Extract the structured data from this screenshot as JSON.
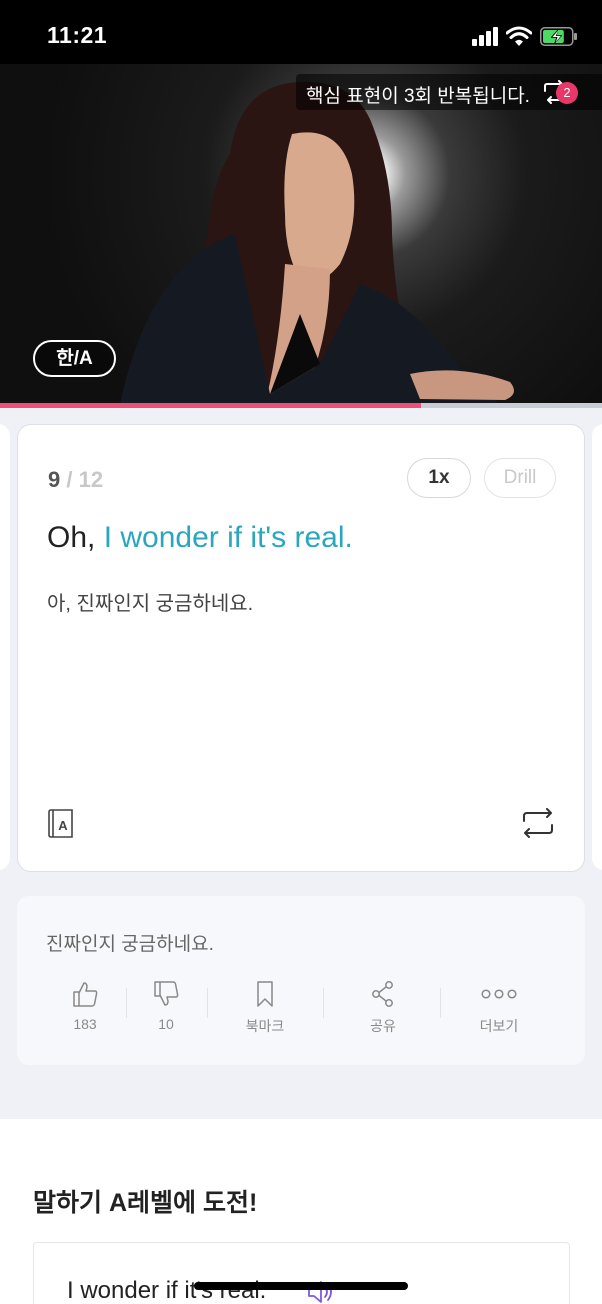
{
  "status_bar": {
    "time": "11:21",
    "battery_level": 0.8
  },
  "video": {
    "repeat_banner": "핵심 표현이 3회 반복됩니다.",
    "repeat_badge": "2",
    "lang_toggle": "한/A",
    "progress": 0.7
  },
  "card": {
    "current": "9",
    "total": "/ 12",
    "speed_label": "1x",
    "drill_label": "Drill",
    "sentence_plain": "Oh,",
    "sentence_highlight": "I wonder if it's real.",
    "translation": "아, 진짜인지 궁금하네요."
  },
  "info": {
    "text": "진짜인지 궁금하네요.",
    "actions": {
      "like": "183",
      "dislike": "10",
      "bookmark": "북마크",
      "share": "공유",
      "more": "더보기"
    }
  },
  "speaking": {
    "title": "말하기 A레벨에 도전!",
    "sentence": "I wonder if it's real."
  },
  "colors": {
    "accent_teal": "#2aa7bd",
    "progress_pink": "#ee4f7a",
    "badge_pink": "#e8386a",
    "speaker_purple": "#7b57e0"
  },
  "icons": [
    "signal-icon",
    "wifi-icon",
    "battery-icon",
    "repeat-icon",
    "dictionary-icon",
    "loop-icon",
    "thumbs-up-icon",
    "thumbs-down-icon",
    "bookmark-icon",
    "share-icon",
    "more-icon",
    "speaker-icon"
  ]
}
